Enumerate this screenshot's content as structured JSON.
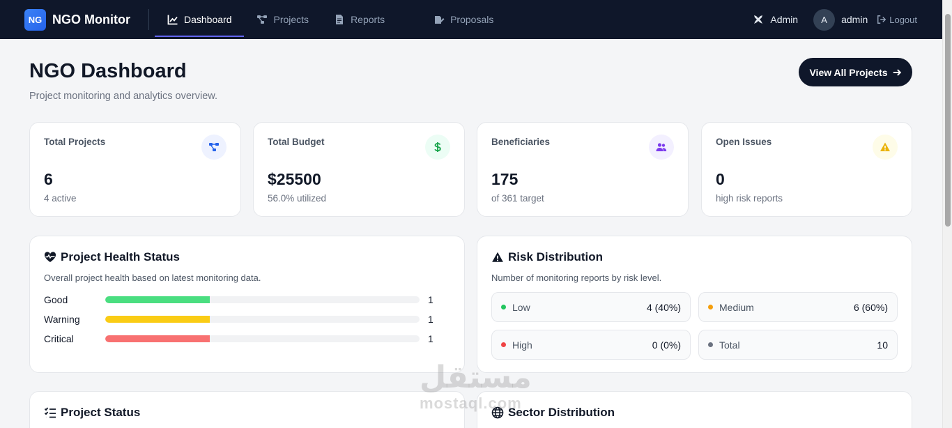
{
  "nav": {
    "brand_logo": "NG",
    "brand_name": "NGO Monitor",
    "links": [
      {
        "label": "Dashboard",
        "icon": "chart-line-icon"
      },
      {
        "label": "Projects",
        "icon": "project-diagram-icon"
      },
      {
        "label": "Reports",
        "icon": "file-icon"
      },
      {
        "label": "Proposals",
        "icon": "edit-document-icon"
      }
    ],
    "admin_label": "Admin",
    "avatar_initial": "A",
    "username": "admin",
    "logout_label": "Logout"
  },
  "header": {
    "title": "NGO Dashboard",
    "subtitle": "Project monitoring and analytics overview.",
    "view_all_label": "View All Projects"
  },
  "stats": [
    {
      "label": "Total Projects",
      "value": "6",
      "sub": "4 active",
      "icon": "project-diagram-icon",
      "color": "#2563eb",
      "bg": "#eef2ff"
    },
    {
      "label": "Total Budget",
      "value": "$25500",
      "sub": "56.0% utilized",
      "icon": "dollar-icon",
      "color": "#16a34a",
      "bg": "#ecfdf5"
    },
    {
      "label": "Beneficiaries",
      "value": "175",
      "sub": "of 361 target",
      "icon": "users-icon",
      "color": "#7c3aed",
      "bg": "#f3f0ff"
    },
    {
      "label": "Open Issues",
      "value": "0",
      "sub": "high risk reports",
      "icon": "warning-icon",
      "color": "#eab308",
      "bg": "#fefce8"
    }
  ],
  "health": {
    "title": "Project Health Status",
    "description": "Overall project health based on latest monitoring data.",
    "rows": [
      {
        "label": "Good",
        "count": "1",
        "fraction": 0.333,
        "color": "#4ade80"
      },
      {
        "label": "Warning",
        "count": "1",
        "fraction": 0.333,
        "color": "#facc15"
      },
      {
        "label": "Critical",
        "count": "1",
        "fraction": 0.333,
        "color": "#f87171"
      }
    ]
  },
  "risk": {
    "title": "Risk Distribution",
    "description": "Number of monitoring reports by risk level.",
    "items": [
      {
        "label": "Low",
        "value": "4 (40%)",
        "color": "#22c55e"
      },
      {
        "label": "Medium",
        "value": "6 (60%)",
        "color": "#f59e0b"
      },
      {
        "label": "High",
        "value": "0 (0%)",
        "color": "#ef4444"
      },
      {
        "label": "Total",
        "value": "10",
        "color": "#6b7280"
      }
    ]
  },
  "lower": {
    "project_status_title": "Project Status",
    "sector_title": "Sector Distribution"
  },
  "watermark": {
    "arabic": "مستقل",
    "latin": "mostaql.com"
  }
}
